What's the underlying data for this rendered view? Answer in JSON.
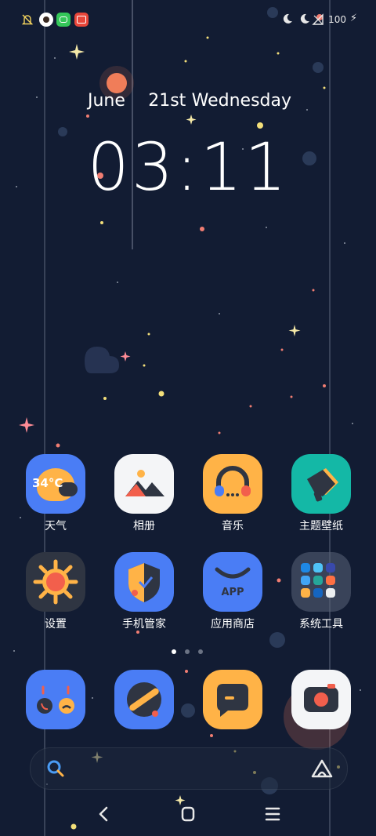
{
  "status_bar": {
    "battery_level": "100"
  },
  "lockscreen": {
    "month": "June",
    "day": "21st",
    "weekday": "Wednesday",
    "time": "03:11"
  },
  "apps_row1": [
    {
      "label": "天气",
      "icon": "weather-icon",
      "badge_text": "34°C"
    },
    {
      "label": "相册",
      "icon": "gallery-icon"
    },
    {
      "label": "音乐",
      "icon": "music-icon"
    },
    {
      "label": "主题壁纸",
      "icon": "theme-icon"
    }
  ],
  "apps_row2": [
    {
      "label": "设置",
      "icon": "settings-icon"
    },
    {
      "label": "手机管家",
      "icon": "phone-manager-icon"
    },
    {
      "label": "应用商店",
      "icon": "app-store-icon",
      "badge_text": "APP"
    },
    {
      "label": "系统工具",
      "icon": "folder-icon"
    }
  ],
  "dock": [
    {
      "name": "phone",
      "icon": "phone-icon"
    },
    {
      "name": "browser",
      "icon": "browser-icon"
    },
    {
      "name": "messages",
      "icon": "message-icon"
    },
    {
      "name": "camera",
      "icon": "camera-icon"
    }
  ],
  "page_indicator": {
    "pages": 3,
    "current": 1
  },
  "colors": {
    "background": "#121c33",
    "blue": "#4a7df5",
    "orange": "#ffb347",
    "teal": "#14b8a6",
    "dark": "#2f3542",
    "red": "#f25f4c"
  }
}
